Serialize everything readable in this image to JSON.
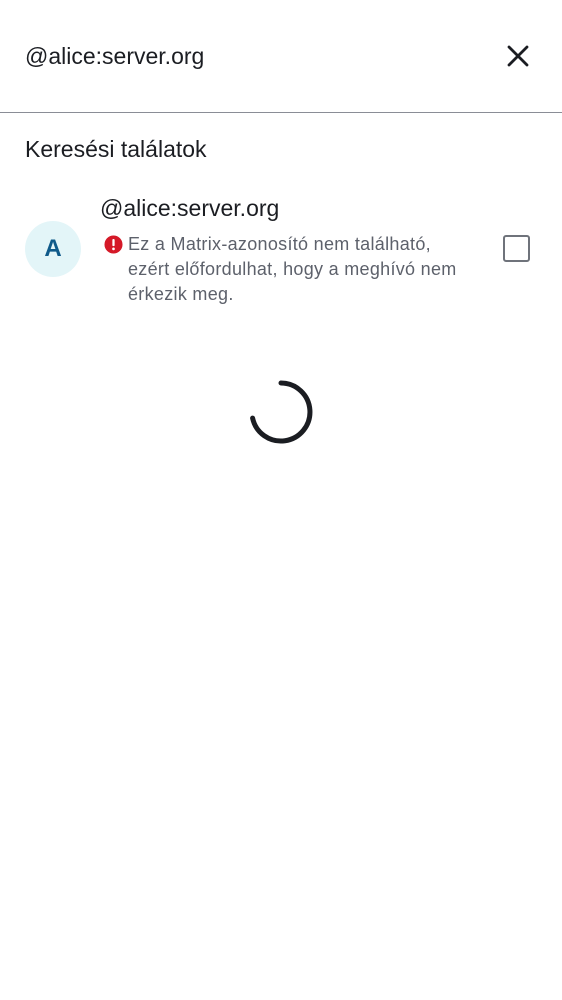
{
  "search": {
    "value": "@alice:server.org",
    "clear_icon": "close-icon"
  },
  "results": {
    "section_title": "Keresési találatok",
    "items": [
      {
        "avatar_letter": "A",
        "name": "@alice:server.org",
        "warning_icon": "error-icon",
        "warning": "Ez a Matrix-azonosító nem található, ezért előfordulhat, hogy a meghívó nem érkezik meg.",
        "selected": false
      }
    ]
  },
  "loading": {
    "icon": "loading-spinner"
  },
  "colors": {
    "text_primary": "#1b1d22",
    "text_secondary": "#5d616b",
    "divider": "#8a8d96",
    "avatar_bg": "#e3f5f8",
    "avatar_fg": "#0f5a8a",
    "error": "#d51928"
  }
}
